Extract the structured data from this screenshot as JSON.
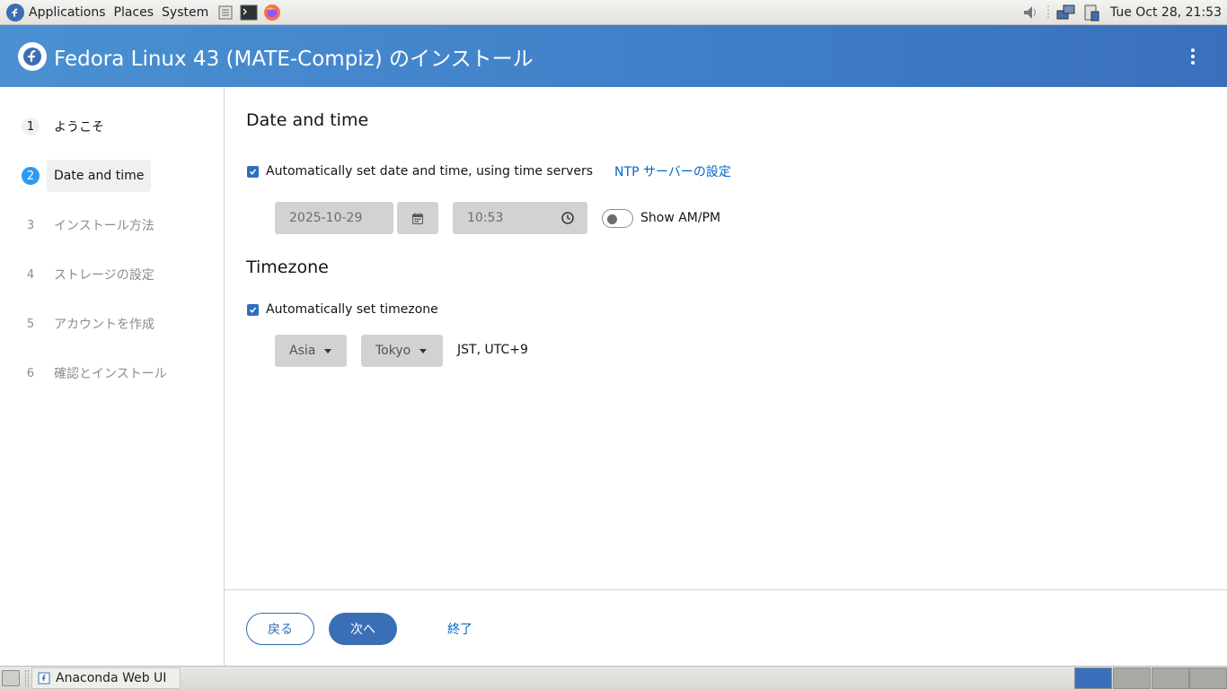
{
  "top_panel": {
    "menus": [
      "Applications",
      "Places",
      "System"
    ],
    "clock": "Tue Oct 28, 21:53"
  },
  "header": {
    "title": "Fedora Linux 43 (MATE-Compiz) のインストール"
  },
  "sidebar": {
    "steps": [
      {
        "num": "1",
        "label": "ようこそ"
      },
      {
        "num": "2",
        "label": "Date and time"
      },
      {
        "num": "3",
        "label": "インストール方法"
      },
      {
        "num": "4",
        "label": "ストレージの設定"
      },
      {
        "num": "5",
        "label": "アカウントを作成"
      },
      {
        "num": "6",
        "label": "確認とインストール"
      }
    ]
  },
  "datetime": {
    "heading": "Date and time",
    "auto_label": "Automatically set date and time, using time servers",
    "ntp_link": "NTP サーバーの設定",
    "date_value": "2025-10-29",
    "time_value": "10:53",
    "ampm_label": "Show AM/PM"
  },
  "timezone": {
    "heading": "Timezone",
    "auto_label": "Automatically set timezone",
    "region": "Asia",
    "city": "Tokyo",
    "offset_text": "JST, UTC+9"
  },
  "footer": {
    "back_label": "戻る",
    "next_label": "次へ",
    "quit_label": "終了"
  },
  "taskbar": {
    "window_label": "Anaconda Web UI"
  },
  "colors": {
    "header_start": "#4a90d2",
    "header_end": "#3a70bb",
    "primary": "#3a6fb5",
    "link": "#0066cc",
    "current_step": "#2b9af3"
  }
}
